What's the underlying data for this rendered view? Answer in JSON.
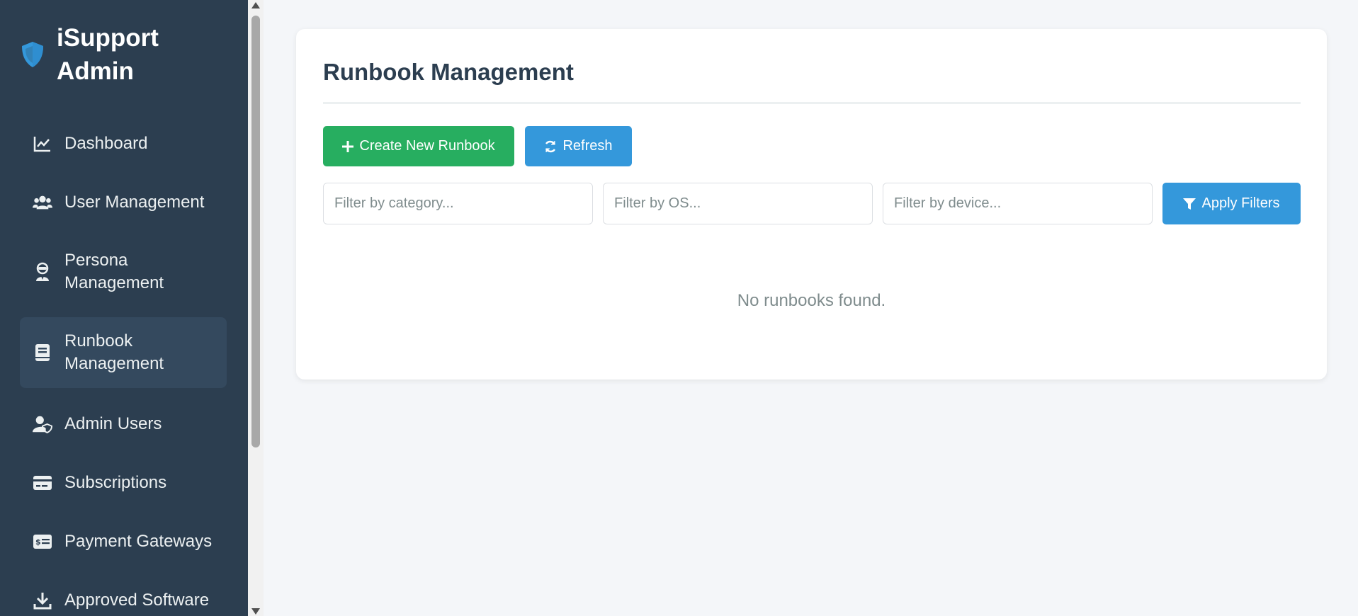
{
  "brand": {
    "title": "iSupport Admin",
    "icon": "shield-icon",
    "icon_color": "#3498db"
  },
  "sidebar": {
    "background": "#2c3e50",
    "active_background": "#34495e",
    "items": [
      {
        "label": "Dashboard",
        "icon": "chart-line-icon"
      },
      {
        "label": "User Management",
        "icon": "users-icon"
      },
      {
        "label": "Persona Management",
        "icon": "user-secret-icon"
      },
      {
        "label": "Runbook Management",
        "icon": "book-icon",
        "active": true
      },
      {
        "label": "Admin Users",
        "icon": "user-shield-icon"
      },
      {
        "label": "Subscriptions",
        "icon": "credit-card-icon"
      },
      {
        "label": "Payment Gateways",
        "icon": "money-check-icon"
      },
      {
        "label": "Approved Software",
        "icon": "download-icon"
      }
    ]
  },
  "main": {
    "title": "Runbook Management",
    "actions": {
      "create_label": "Create New Runbook",
      "create_icon": "plus-icon",
      "create_color": "#27ae60",
      "refresh_label": "Refresh",
      "refresh_icon": "sync-icon",
      "refresh_color": "#3498db"
    },
    "filters": {
      "category_placeholder": "Filter by category...",
      "os_placeholder": "Filter by OS...",
      "device_placeholder": "Filter by device...",
      "apply_label": "Apply Filters",
      "apply_icon": "filter-icon"
    },
    "empty_message": "No runbooks found."
  }
}
